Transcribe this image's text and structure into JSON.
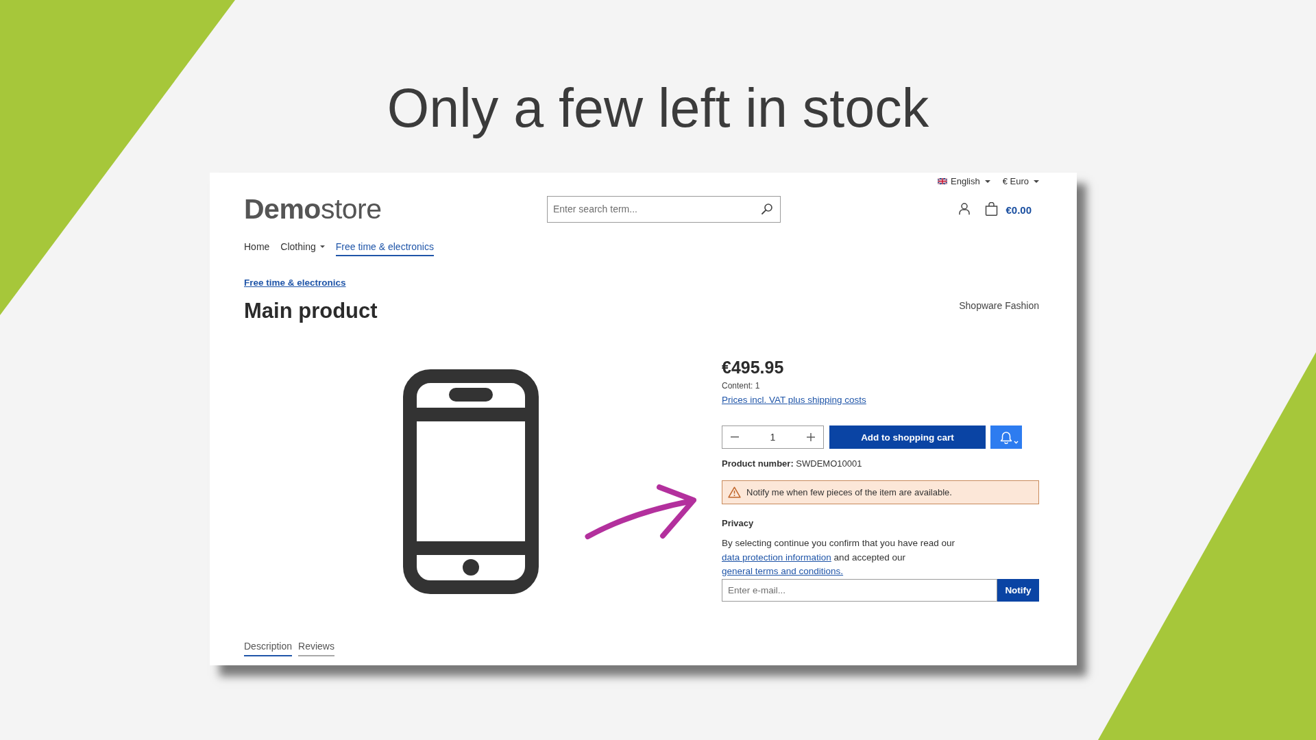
{
  "headline": "Only a few left in stock",
  "store": {
    "top_bar": [
      {
        "kind": "language",
        "label": "English"
      },
      {
        "kind": "currency",
        "label": "€ Euro"
      }
    ],
    "logo": "**Demo**store",
    "search": {
      "placeholder": "Enter search term..."
    },
    "cart_total": "€0.00",
    "nav": [
      {
        "label": "Home",
        "selected": false,
        "has_menu": false
      },
      {
        "label": "Clothing",
        "selected": false,
        "has_menu": true
      },
      {
        "label": "Free time & electronics",
        "selected": true,
        "has_menu": false
      }
    ],
    "breadcrumb": "Free time & electronics",
    "product": {
      "title": "Main product",
      "manufacturer": "Shopware Fashion",
      "price": "€495.95",
      "content": "Content: 1",
      "price_note": "Prices incl. VAT plus shipping costs",
      "quantity": "1",
      "add_to_cart": "Add to shopping cart",
      "product_number": "**Product number:** SWDEMO10001",
      "stock_alert": "Notify me when few pieces of the item are available.",
      "privacy": {
        "heading": "Privacy",
        "parts": [
          {
            "kind": "text",
            "text": "By selecting continue you confirm that you have read our "
          },
          {
            "kind": "link",
            "text": "data protection information"
          },
          {
            "kind": "text",
            "text": " and accepted our "
          },
          {
            "kind": "link",
            "text": "general terms and conditions."
          }
        ]
      },
      "email": {
        "placeholder": "Enter e-mail...",
        "button": "Notify"
      }
    },
    "tabs": [
      {
        "label": "Description",
        "selected": true
      },
      {
        "label": "Reviews",
        "selected": false
      }
    ]
  }
}
